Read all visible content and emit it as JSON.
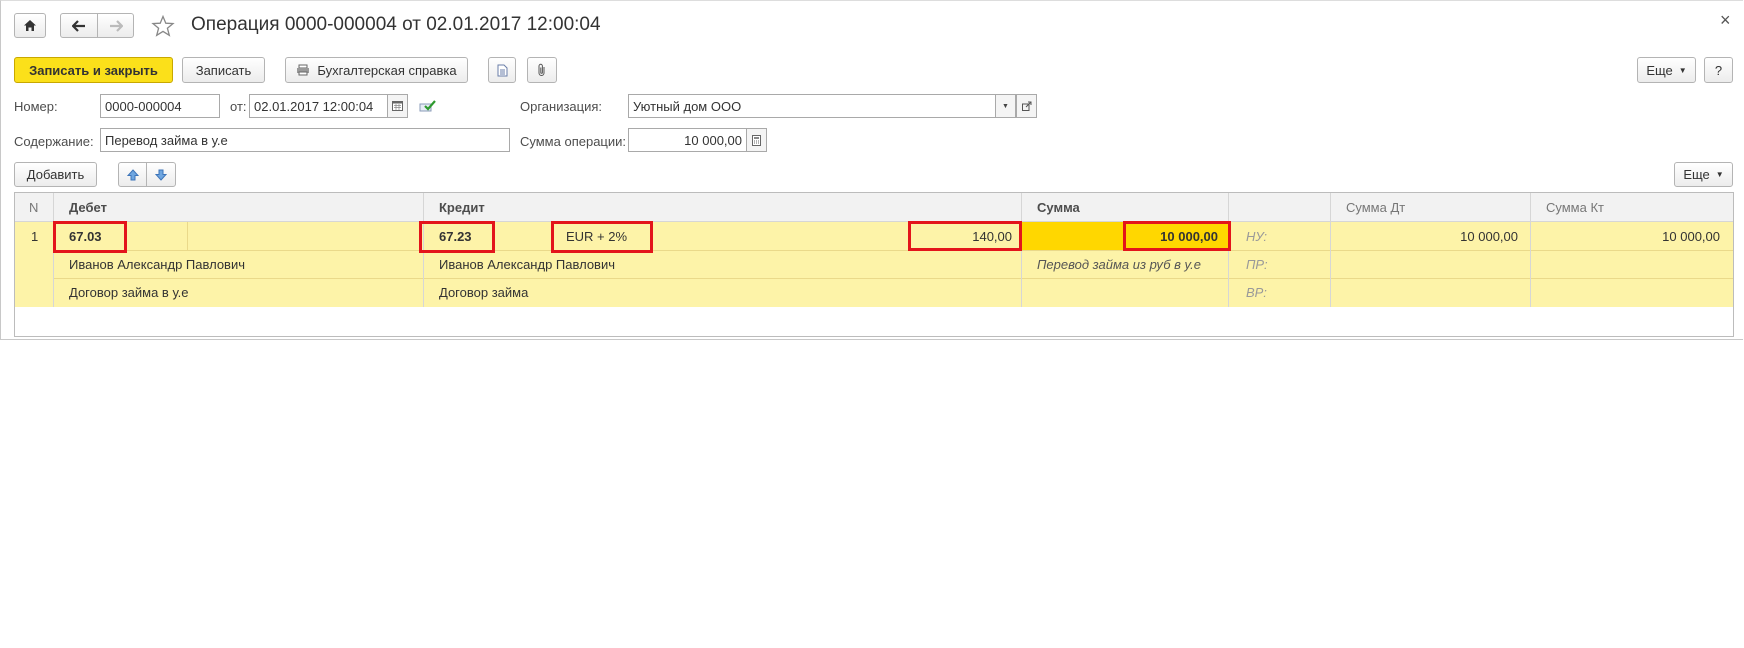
{
  "window": {
    "title": "Операция 0000-000004 от 02.01.2017 12:00:04",
    "close_glyph": "×"
  },
  "toolbar": {
    "save_close_label": "Записать и закрыть",
    "save_label": "Записать",
    "report_label": "Бухгалтерская справка",
    "more_label": "Еще",
    "help_label": "?"
  },
  "form": {
    "number_label": "Номер:",
    "number_value": "0000-000004",
    "date_label": "от:",
    "date_value": "02.01.2017 12:00:04",
    "org_label": "Организация:",
    "org_value": "Уютный дом ООО",
    "content_label": "Содержание:",
    "content_value": "Перевод займа в у.е",
    "sum_label": "Сумма операции:",
    "sum_value": "10 000,00"
  },
  "table_toolbar": {
    "add_label": "Добавить",
    "more_label": "Еще"
  },
  "table": {
    "columns": {
      "n": "N",
      "debit": "Дебет",
      "credit": "Кредит",
      "sum": "Сумма",
      "sum_dt": "Сумма Дт",
      "sum_kt": "Сумма Кт"
    },
    "row": {
      "n": "1",
      "debit_account": "67.03",
      "debit_sub1": "Иванов Александр Павлович",
      "debit_sub2": "Договор займа в у.е",
      "credit_account": "67.23",
      "credit_currency": "EUR + 2%",
      "credit_sub1": "Иванов Александр Павлович",
      "credit_sub2": "Договор займа",
      "currency_amount": "140,00",
      "sum": "10 000,00",
      "sum_comment": "Перевод займа из руб в у.е",
      "nu_label": "НУ:",
      "pr_label": "ПР:",
      "vr_label": "ВР:",
      "sum_dt": "10 000,00",
      "sum_kt": "10 000,00"
    }
  },
  "colors": {
    "primary_button": "#fbe01a",
    "row_highlight": "#fdf3a8",
    "active_cell": "#ffd700",
    "annotation_border": "#e3141b"
  }
}
